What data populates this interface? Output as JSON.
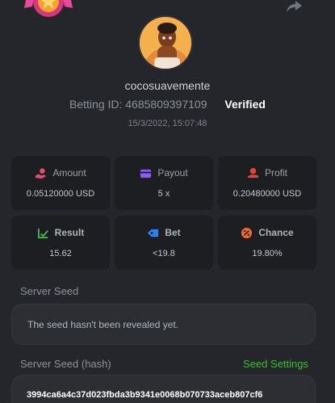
{
  "profile": {
    "username": "cocosuavemente",
    "betting_id_label": "Betting ID: 4685809397109",
    "verified_label": "Verified",
    "timestamp": "15/3/2022, 15:07:48"
  },
  "stats": [
    {
      "label": "Amount",
      "value": "0.05120000 USD",
      "icon": "money-hand-icon",
      "color": "#e84b6b"
    },
    {
      "label": "Payout",
      "value": "5 x",
      "icon": "wallet-icon",
      "color": "#8d5cf6"
    },
    {
      "label": "Profit",
      "value": "0.20480000 USD",
      "icon": "coins-hand-icon",
      "color": "#e2433f"
    },
    {
      "label": "Result",
      "value": "15.62",
      "icon": "chart-check-icon",
      "color": "#46b84a"
    },
    {
      "label": "Bet",
      "value": "<19.8",
      "icon": "tag-icon",
      "color": "#2f7ff0"
    },
    {
      "label": "Chance",
      "value": "19.80%",
      "icon": "percent-icon",
      "color": "#f06b2b"
    }
  ],
  "server_seed": {
    "label": "Server Seed",
    "message": "The seed hasn't been revealed yet."
  },
  "server_seed_hash": {
    "label": "Server Seed (hash)",
    "settings_label": "Seed Settings",
    "hash": "3994ca6a4c37d023fbda3b9341e0068b070733aceb807cf6"
  },
  "colors": {
    "background": "#24262b",
    "card": "#1c1e22",
    "accent_green": "#3fba3b"
  }
}
